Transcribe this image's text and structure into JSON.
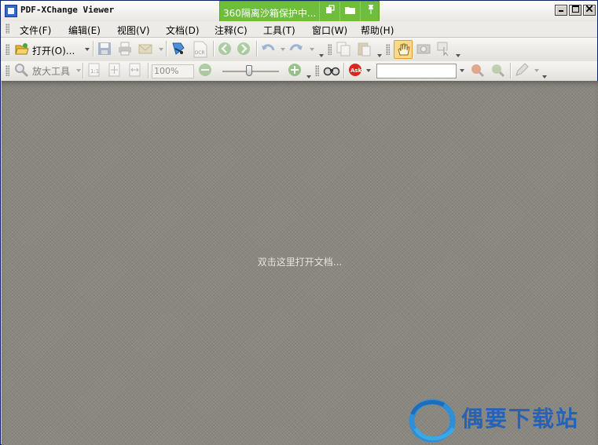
{
  "window": {
    "title": "PDF-XChange Viewer"
  },
  "sandbox_banner": {
    "text": "360隔离沙箱保护中...",
    "color": "#6ebd3d"
  },
  "menu": {
    "items": [
      "文件(F)",
      "编辑(E)",
      "视图(V)",
      "文档(D)",
      "注释(C)",
      "工具(T)",
      "窗口(W)",
      "帮助(H)"
    ]
  },
  "toolbar1": {
    "open_label": "打开(O)..."
  },
  "toolbar2": {
    "zoom_tool_label": "放大工具",
    "zoom_value": "100%",
    "zoom_level_percent": 100
  },
  "document": {
    "hint": "双击这里打开文档..."
  },
  "watermark": {
    "text": "偶要下载站"
  }
}
